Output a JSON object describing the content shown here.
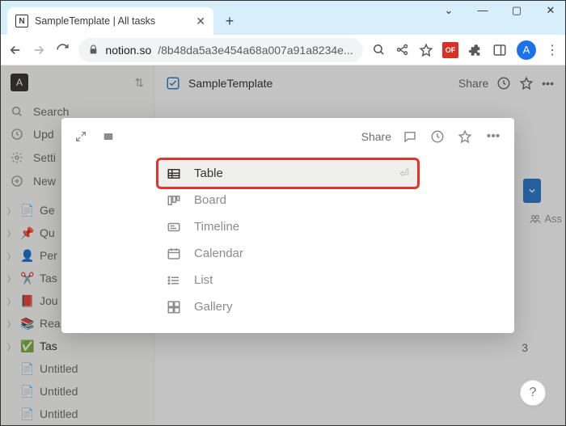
{
  "browser": {
    "tab_title": "SampleTemplate | All tasks",
    "url_host": "notion.so",
    "url_path": "/8b48da5a3e454a68a007a91a8234e...",
    "win": {
      "down": "⌄",
      "min": "—",
      "max": "▢",
      "close": "✕"
    },
    "ext_badge": "OF",
    "avatar": "A"
  },
  "sidebar": {
    "workspace_letter": "A",
    "search": "Search",
    "updates": "Upd",
    "settings": "Setti",
    "new_page": "New",
    "pages": [
      {
        "emoji": "📄",
        "label": "Ge"
      },
      {
        "emoji": "📌",
        "label": "Qu"
      },
      {
        "emoji": "👤",
        "label": "Per"
      },
      {
        "emoji": "✂️",
        "label": "Tas"
      },
      {
        "emoji": "📕",
        "label": "Jou"
      },
      {
        "emoji": "📚",
        "label": "Rea"
      },
      {
        "emoji": "✅",
        "label": "Tas",
        "on": true
      },
      {
        "emoji": "📄",
        "label": "Untitled"
      },
      {
        "emoji": "📄",
        "label": "Untitled"
      },
      {
        "emoji": "📄",
        "label": "Untitled"
      }
    ]
  },
  "main": {
    "title": "SampleTemplate",
    "share": "Share",
    "assign_hint": "Ass",
    "stray_digit": "3"
  },
  "popover": {
    "share": "Share",
    "views": [
      {
        "label": "Table",
        "selected": true
      },
      {
        "label": "Board"
      },
      {
        "label": "Timeline"
      },
      {
        "label": "Calendar"
      },
      {
        "label": "List"
      },
      {
        "label": "Gallery"
      }
    ]
  },
  "help": "?"
}
